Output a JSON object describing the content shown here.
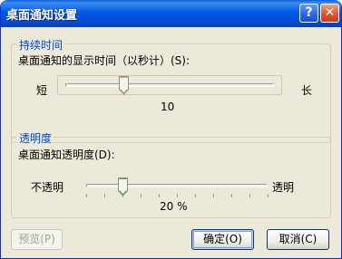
{
  "window": {
    "title": "桌面通知设置",
    "help_label": "?",
    "close_label": "✕"
  },
  "duration_group": {
    "title": "持续时间",
    "description": "桌面通知的显示时间（以秒计）(S):",
    "min_label": "短",
    "max_label": "长",
    "value_text": "10",
    "slider_fraction": 0.28
  },
  "transparency_group": {
    "title": "透明度",
    "description": "桌面通知透明度(D):",
    "min_label": "不透明",
    "max_label": "透明",
    "value_text": "20 %",
    "slider_fraction": 0.2
  },
  "buttons": {
    "preview_label": "预览(P)",
    "ok_label": "确定(O)",
    "cancel_label": "取消(C)"
  },
  "icons": {
    "help": "help-icon",
    "close": "close-icon"
  },
  "colors": {
    "titlebar": "#0058e6",
    "group_title": "#0046d5",
    "dialog_bg": "#ece9d8",
    "thumb_accent": "#4cbb17"
  }
}
